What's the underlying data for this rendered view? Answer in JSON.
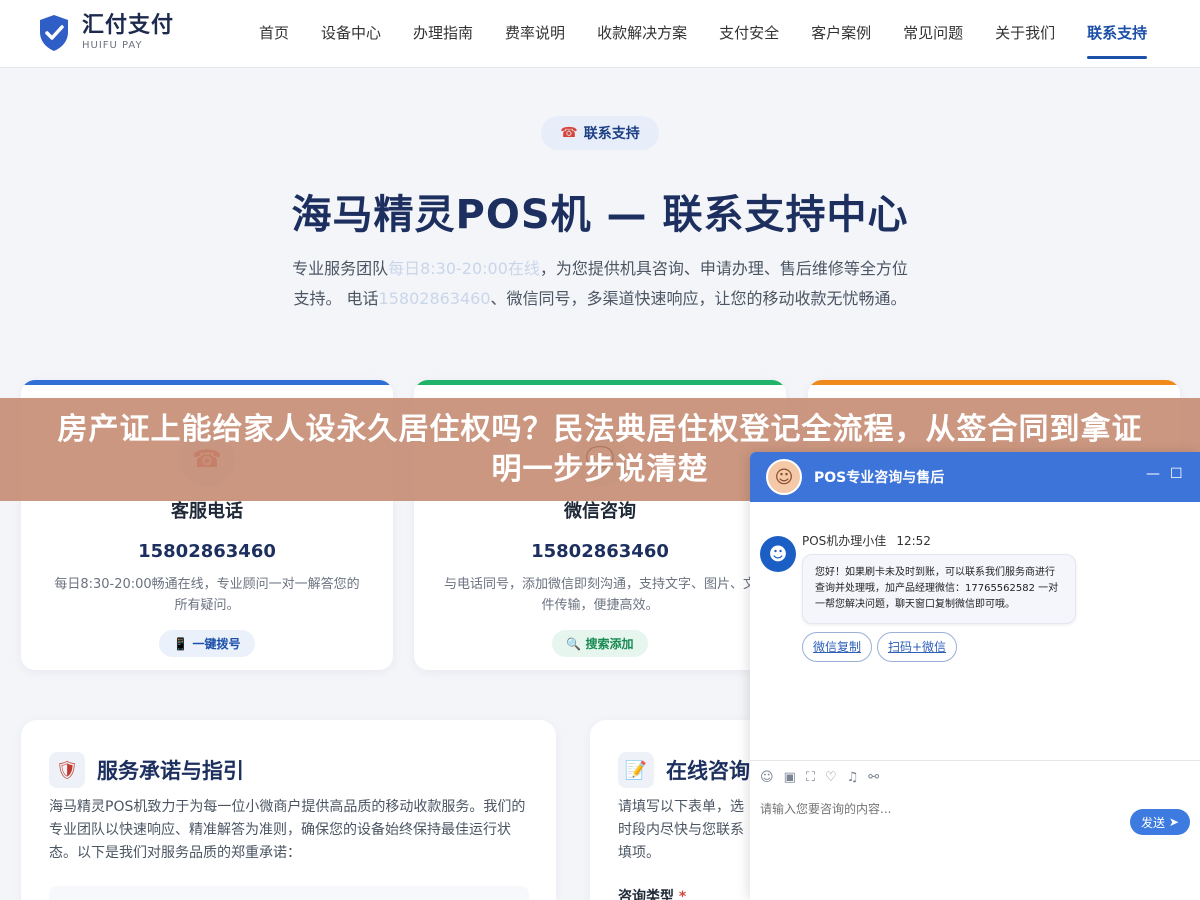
{
  "header": {
    "logo_cn": "汇付支付",
    "logo_en": "HUIFU PAY",
    "nav": [
      "首页",
      "设备中心",
      "办理指南",
      "费率说明",
      "收款解决方案",
      "支付安全",
      "客户案例",
      "常见问题",
      "关于我们",
      "联系支持"
    ],
    "active_nav": "联系支持"
  },
  "hero": {
    "badge": "联系支持",
    "title": "海马精灵POS机 — 联系支持中心",
    "desc_part1": "专业服务团队",
    "desc_hl1": "每日8:30-20:00在线",
    "desc_part2": "，为您提供机具咨询、申请办理、售后维修等全方位支持。 电话",
    "desc_hl2": "15802863460",
    "desc_part3": "、微信同号，多渠道快速响应，让您的移动收款无忧畅通。"
  },
  "cards": [
    {
      "title": "客服电话",
      "number": "15802863460",
      "desc": "每日8:30-20:00畅通在线，专业顾问一对一解答您的所有疑问。",
      "button": "一键拨号",
      "icon": "phone-icon",
      "color": "#2f6fd6"
    },
    {
      "title": "微信咨询",
      "number": "15802863460",
      "desc": "与电话同号，添加微信即刻沟通，支持文字、图片、文件传输，便捷高效。",
      "button": "搜索添加",
      "icon": "wechat-icon",
      "color": "#20b36a"
    },
    {
      "title": "",
      "number": "",
      "desc": "",
      "button": "",
      "icon": "mail-icon",
      "color": "#f08a1c"
    }
  ],
  "panels": {
    "service": {
      "title": "服务承诺与指引",
      "text": "海马精灵POS机致力于为每一位小微商户提供高品质的移动收款服务。我们的专业团队以快速响应、精准解答为准则，确保您的设备始终保持最佳运行状态。以下是我们对服务品质的郑重承诺："
    },
    "consult": {
      "title": "在线咨询",
      "text_l1": "请填写以下表单，选",
      "text_l2": "时段内尽快与您联系",
      "text_l3": "填项。",
      "field_label": "咨询类型",
      "required_mark": "*"
    }
  },
  "banner": {
    "text": "房产证上能给家人设永久居住权吗？民法典居住权登记全流程，从签合同到拿证明一步步说清楚"
  },
  "chat": {
    "title": "POS专业咨询与售后",
    "agent_name": "POS机办理小佳",
    "time": "12:52",
    "message": "您好！如果刷卡未及时到账，可以联系我们服务商进行查询并处理哦，加产品经理微信：17765562582 一对一帮您解决问题，聊天窗口复制微信即可哦。",
    "quick_buttons": [
      "微信复制",
      "扫码+微信"
    ],
    "input_placeholder": "请输入您要咨询的内容...",
    "send_label": "发送",
    "min_symbol": "—",
    "max_symbol": "☐"
  }
}
